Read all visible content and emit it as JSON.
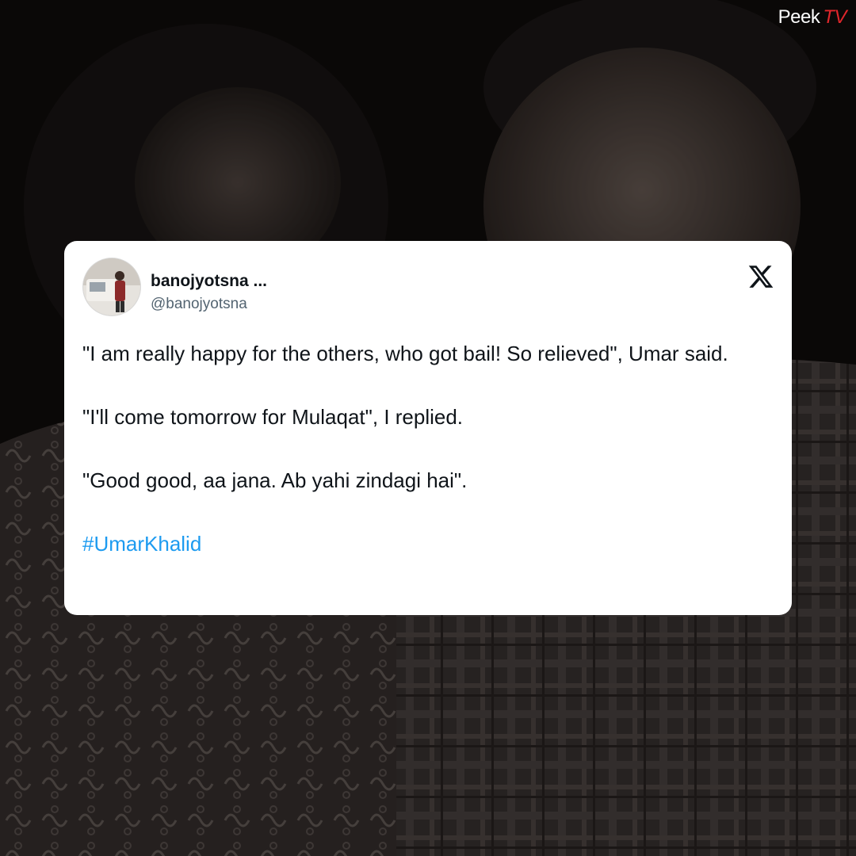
{
  "watermark": {
    "brand_part1": "Peek",
    "brand_part2": "TV",
    "accent_color": "#e0262b"
  },
  "tweet": {
    "display_name": "banojyotsna ...",
    "handle": "@banojyotsna",
    "platform_icon": "x-logo-icon",
    "paragraphs": [
      "\"I am really happy for the others, who got bail! So relieved\", Umar said.",
      "\"I'll come tomorrow for Mulaqat\", I replied.",
      "\"Good good, aa jana. Ab yahi zindagi hai\"."
    ],
    "hashtag": "#UmarKhalid",
    "hashtag_color": "#1d9bf0"
  }
}
